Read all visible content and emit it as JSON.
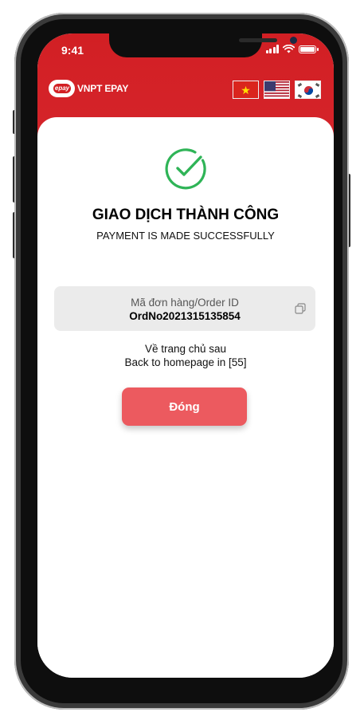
{
  "status_bar": {
    "time": "9:41"
  },
  "header": {
    "logo_badge": "epay",
    "logo_text": "VNPT EPAY"
  },
  "languages": [
    "vi",
    "en",
    "ko"
  ],
  "result": {
    "icon": "check-circle-icon",
    "title": "GIAO DỊCH THÀNH CÔNG",
    "subtitle": "PAYMENT IS MADE SUCCESSFULLY"
  },
  "order": {
    "label": "Mã đơn hàng/Order ID",
    "value": "OrdNo2021315135854"
  },
  "redirect": {
    "line_vi": "Về trang chủ sau",
    "line_en": "Back to homepage in [55]"
  },
  "close_button": {
    "label": "Đóng"
  },
  "colors": {
    "header_red": "#d21f24",
    "button_red": "#ec5a5f",
    "success_green": "#2fb457"
  }
}
